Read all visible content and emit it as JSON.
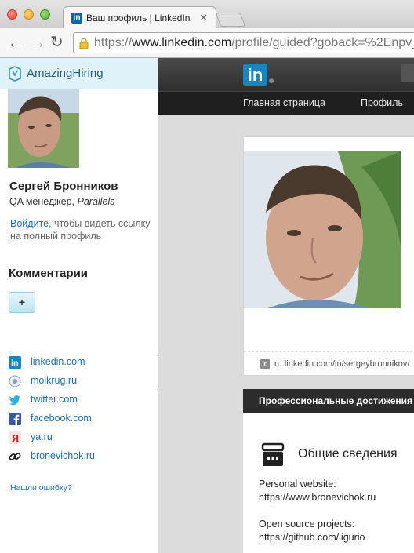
{
  "browser": {
    "tab_title": "Ваш профиль | LinkedIn",
    "tab_favicon": "in",
    "url_scheme": "https://",
    "url_host": "www.linkedin.com",
    "url_rest": "/profile/guided?goback=%2Enpv_"
  },
  "sidebar": {
    "brand": "AmazingHiring",
    "name": "Сергей Бронников",
    "role": "QA менеджер,",
    "company": "Parallels",
    "login_link": "Войдите",
    "login_text": ", чтобы видеть ссылку на полный профиль",
    "comments_title": "Комментарии",
    "add_label": "+",
    "links": [
      {
        "icon": "linkedin-icon",
        "label": "linkedin.com"
      },
      {
        "icon": "moikrug-icon",
        "label": "moikrug.ru"
      },
      {
        "icon": "twitter-icon",
        "label": "twitter.com"
      },
      {
        "icon": "facebook-icon",
        "label": "facebook.com"
      },
      {
        "icon": "yandex-icon",
        "label": "ya.ru"
      },
      {
        "icon": "chain-link-icon",
        "label": "bronevichok.ru"
      }
    ],
    "report_error": "Нашли ошибку?"
  },
  "linkedin": {
    "logo": "in",
    "nav": [
      "Главная страница",
      "Профиль"
    ],
    "profile_url": "ru.linkedin.com/in/sergeybronnikov/",
    "section_bar": "Профессиональные достижения",
    "info_title": "Общие сведения",
    "website_label": "Personal website:",
    "website_value": "https://www.bronevichok.ru",
    "oss_label": "Open source projects:",
    "oss_value": "https://github.com/ligurio"
  },
  "colors": {
    "link_blue": "#1f6fae",
    "linkedin_blue": "#1a84bc",
    "ah_header": "#dff1f9"
  }
}
